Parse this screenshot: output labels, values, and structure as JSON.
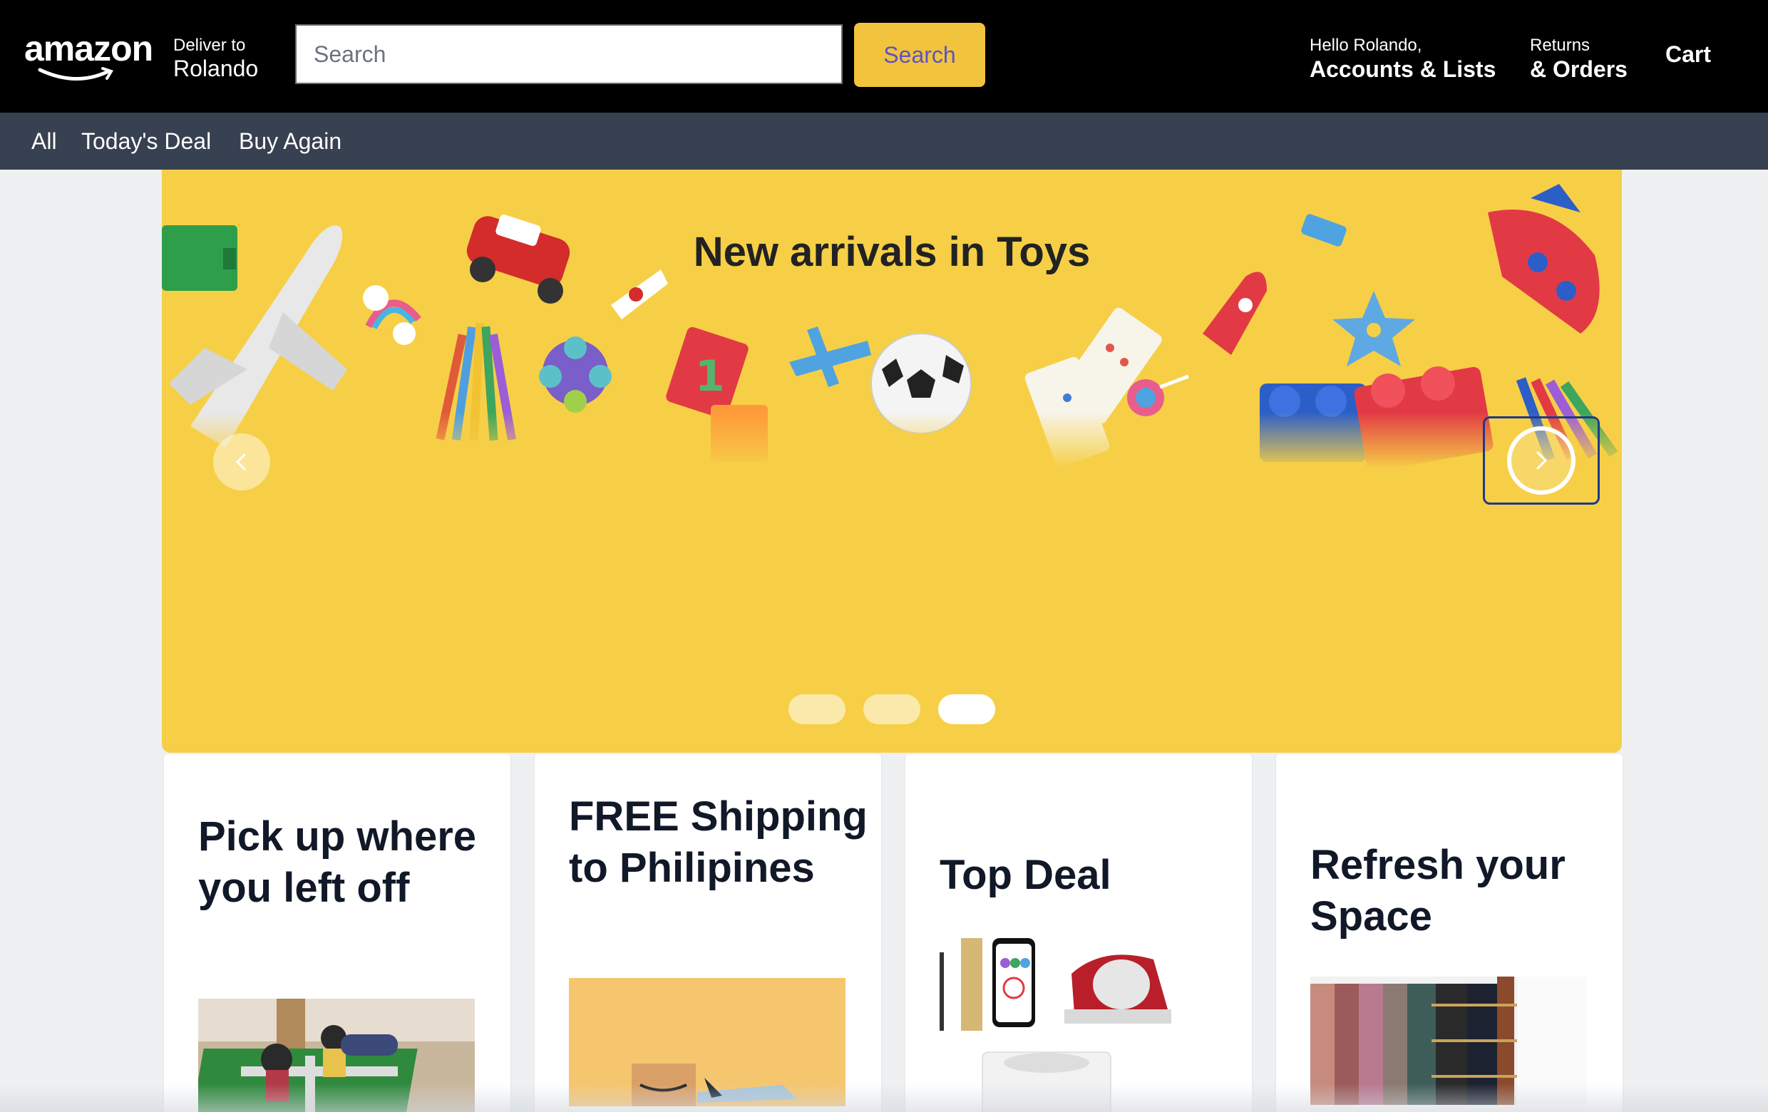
{
  "header": {
    "logo_text": "amazon",
    "deliver_label": "Deliver to",
    "deliver_name": "Rolando",
    "search_placeholder": "Search",
    "search_button": "Search",
    "greeting": "Hello Rolando,",
    "accounts_label": "Accounts & Lists",
    "returns_label": "Returns",
    "orders_label": "& Orders",
    "cart_label": "Cart"
  },
  "subnav": {
    "items": [
      "All",
      "Today's Deal",
      "Buy Again"
    ]
  },
  "hero": {
    "title": "New arrivals in Toys",
    "slide_count": 3,
    "active_slide": 3
  },
  "cards": [
    {
      "title": "Pick up where you left off"
    },
    {
      "title": "FREE Shipping to Philipines"
    },
    {
      "title": "Top Deal"
    },
    {
      "title": "Refresh your Space"
    }
  ],
  "colors": {
    "header_bg": "#000000",
    "subnav_bg": "#374151",
    "accent_yellow": "#f2c33c",
    "hero_bg": "#f6cf47",
    "page_bg": "#eef0f2"
  }
}
